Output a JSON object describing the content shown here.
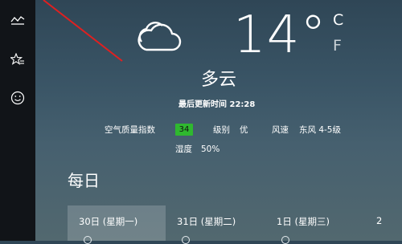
{
  "current": {
    "temperature": "14°",
    "unit_c": "C",
    "unit_f": "F",
    "condition": "多云",
    "updated": "最后更新时间 22:28"
  },
  "details": {
    "aqi_label": "空气质量指数",
    "aqi_value": "34",
    "level_label": "级别",
    "level_value": "优",
    "wind_label": "风速",
    "wind_value": "东风 4-5级",
    "humidity_label": "湿度",
    "humidity_value": "50%"
  },
  "daily": {
    "title": "每日",
    "days": [
      {
        "label": "30日 (星期一)"
      },
      {
        "label": "31日 (星期二)"
      },
      {
        "label": "1日 (星期三)"
      },
      {
        "label": "2"
      }
    ]
  },
  "colors": {
    "aqi_badge": "#2fb82f",
    "sidebar": "#111418",
    "annotation_line": "#e02020"
  },
  "icons": [
    "history-chart-icon",
    "favorites-star-icon",
    "feedback-smiley-icon",
    "cloud-icon"
  ]
}
